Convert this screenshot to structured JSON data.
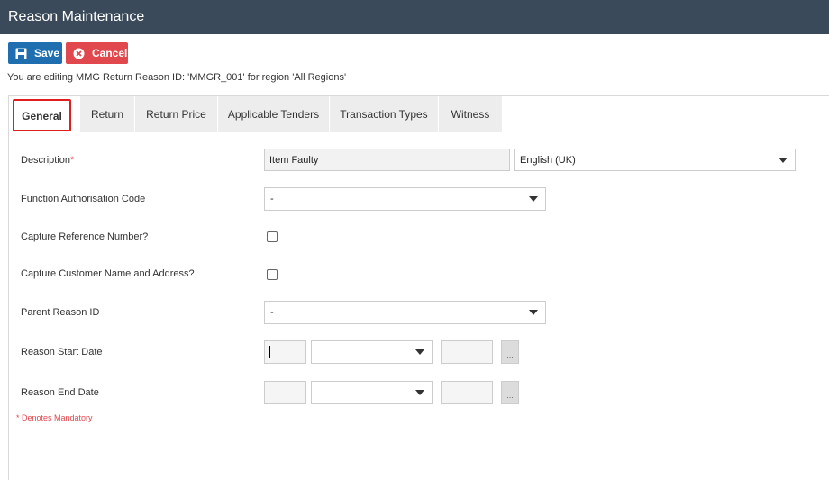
{
  "header": {
    "title": "Reason Maintenance"
  },
  "toolbar": {
    "save_label": "Save",
    "cancel_label": "Cancel"
  },
  "editing_message": "You are editing MMG Return Reason ID: 'MMGR_001' for region 'All Regions'",
  "tabs": [
    {
      "label": "General",
      "active": true
    },
    {
      "label": "Return"
    },
    {
      "label": "Return Price"
    },
    {
      "label": "Applicable Tenders"
    },
    {
      "label": "Transaction Types"
    },
    {
      "label": "Witness"
    }
  ],
  "form": {
    "description": {
      "label": "Description",
      "required_mark": "*",
      "value": "Item Faulty",
      "language": "English (UK)"
    },
    "function_auth": {
      "label": "Function Authorisation Code",
      "value": "-"
    },
    "capture_ref": {
      "label": "Capture Reference Number?",
      "checked": false
    },
    "capture_customer": {
      "label": "Capture Customer Name and Address?",
      "checked": false
    },
    "parent_reason": {
      "label": "Parent Reason ID",
      "value": "-"
    },
    "start_date": {
      "label": "Reason Start Date",
      "button": "..."
    },
    "end_date": {
      "label": "Reason End Date",
      "button": "..."
    }
  },
  "mandatory_note": "* Denotes Mandatory",
  "colors": {
    "header_bg": "#3b4a5a",
    "save": "#1f6fb0",
    "cancel": "#e0484e",
    "active_tab_border": "#e01e1e"
  },
  "icons": {
    "save": "floppy-disk-icon",
    "cancel": "close-circle-icon",
    "dropdown": "caret-down-icon"
  }
}
